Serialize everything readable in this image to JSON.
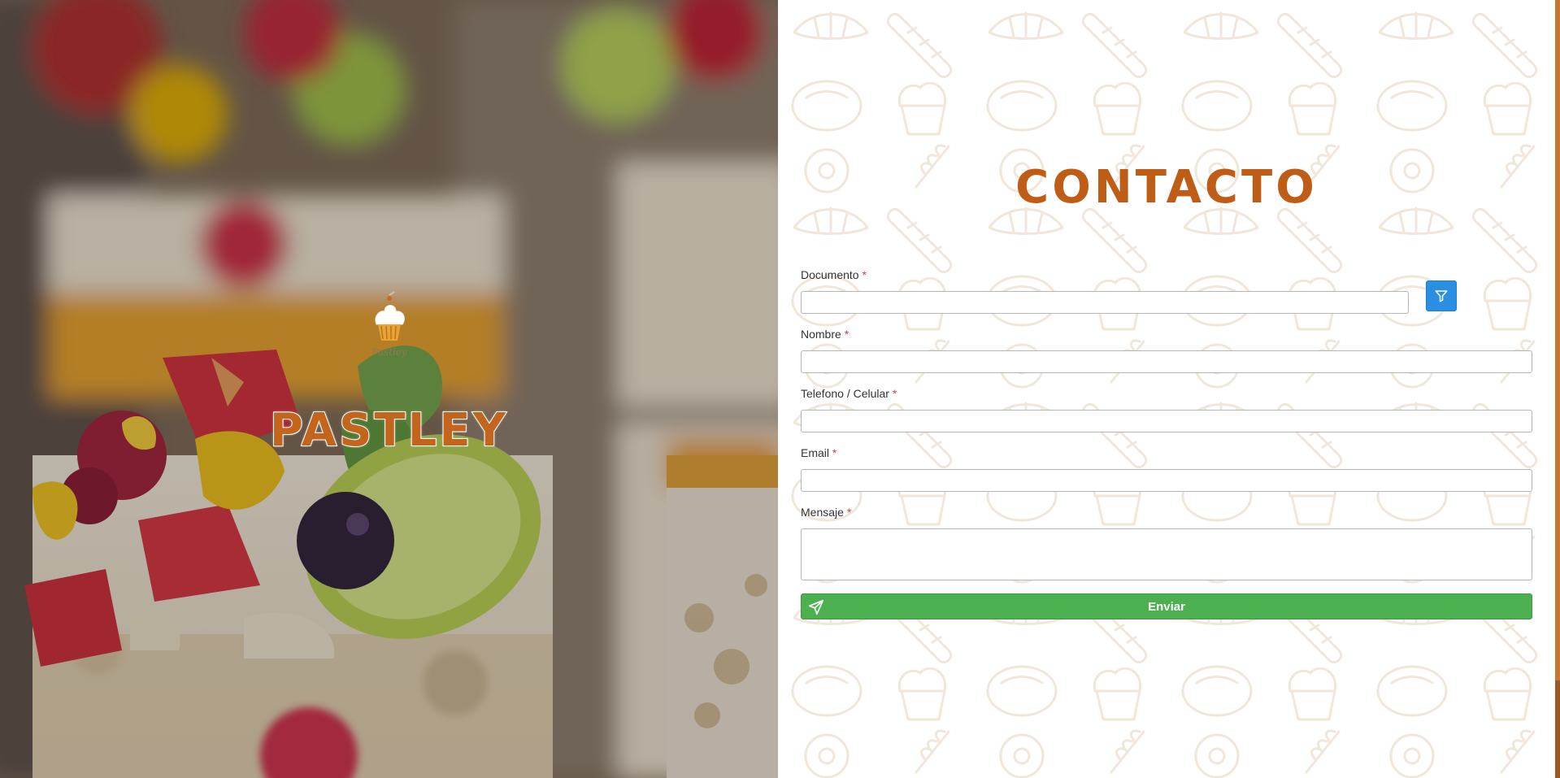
{
  "hero": {
    "brand_name": "PASTLEY",
    "logo_icon": "cupcake-logo-icon"
  },
  "contact": {
    "title": "CONTACTO",
    "required_marker": "*",
    "fields": {
      "documento": {
        "label": "Documento",
        "value": ""
      },
      "nombre": {
        "label": "Nombre",
        "value": ""
      },
      "telefono": {
        "label": "Telefono / Celular",
        "value": ""
      },
      "email": {
        "label": "Email",
        "value": ""
      },
      "mensaje": {
        "label": "Mensaje",
        "value": ""
      }
    },
    "filter_button_icon": "filter-icon",
    "send_button": {
      "label": "Enviar",
      "icon": "paper-plane-icon"
    }
  },
  "colors": {
    "brand_orange": "#bf5d16",
    "filter_blue": "#2a8fe0",
    "send_green": "#4caf50",
    "required_red": "#e53935"
  }
}
